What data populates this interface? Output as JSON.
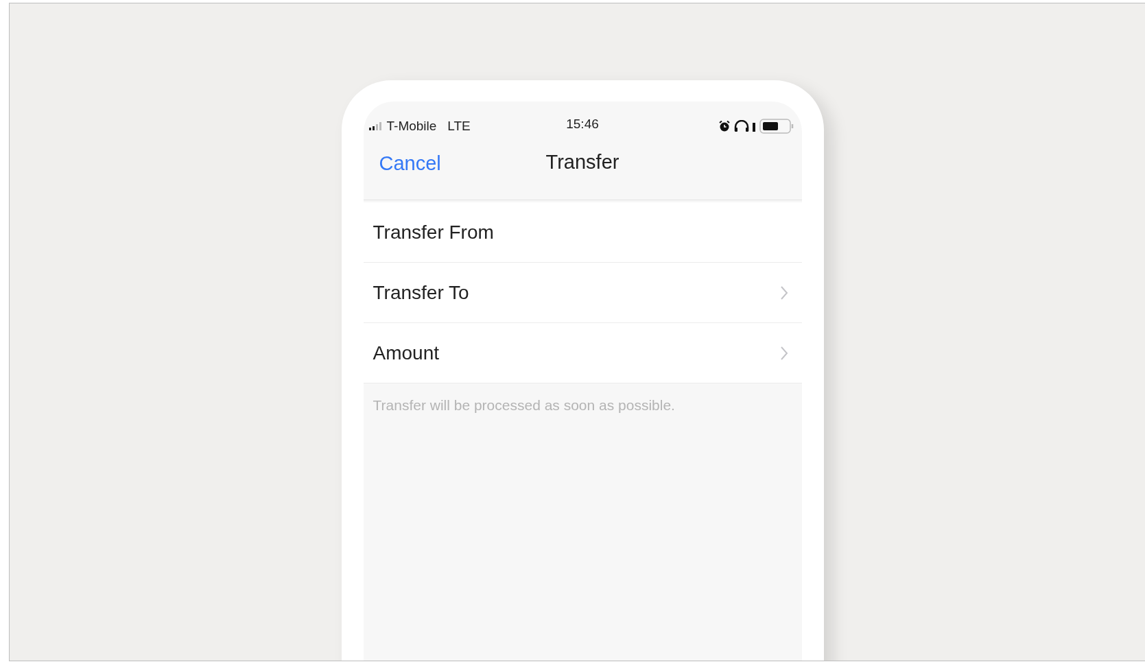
{
  "status_bar": {
    "carrier": "T-Mobile",
    "network": "LTE",
    "time": "15:46"
  },
  "nav": {
    "cancel": "Cancel",
    "title": "Transfer"
  },
  "rows": [
    {
      "label": "Transfer From",
      "chevron": false
    },
    {
      "label": "Transfer To",
      "chevron": true
    },
    {
      "label": "Amount",
      "chevron": true
    }
  ],
  "footer_note": "Transfer will be processed as soon as possible."
}
